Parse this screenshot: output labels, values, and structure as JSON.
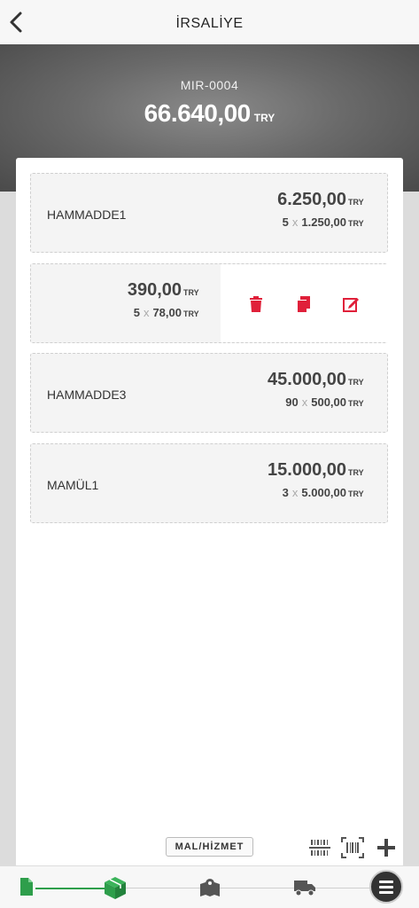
{
  "header": {
    "title": "İRSALİYE",
    "back_icon": "chevron-left-icon"
  },
  "summary": {
    "document_no": "MIR-0004",
    "total": "66.640,00",
    "currency": "TRY"
  },
  "items": [
    {
      "name": "HAMMADDE1",
      "line_total": "6.250,00",
      "currency": "TRY",
      "qty": "5",
      "x": "x",
      "unit_price": "1.250,00",
      "unit_currency": "TRY"
    },
    {
      "name": "",
      "line_total": "390,00",
      "currency": "TRY",
      "qty": "5",
      "x": "x",
      "unit_price": "78,00",
      "unit_currency": "TRY",
      "swiped": true
    },
    {
      "name": "HAMMADDE3",
      "line_total": "45.000,00",
      "currency": "TRY",
      "qty": "90",
      "x": "x",
      "unit_price": "500,00",
      "unit_currency": "TRY"
    },
    {
      "name": "MAMÜL1",
      "line_total": "15.000,00",
      "currency": "TRY",
      "qty": "3",
      "x": "x",
      "unit_price": "5.000,00",
      "unit_currency": "TRY"
    }
  ],
  "swipe_actions": [
    "trash-icon",
    "copy-icon",
    "edit-icon"
  ],
  "toolbar": {
    "mal_hizmet_label": "MAL/HİZMET"
  },
  "colors": {
    "accent_red": "#e0203a",
    "accent_green": "#2e9e4b",
    "hero_dark": "#4a4a4a"
  },
  "bottom_nav": [
    "document-icon",
    "package-icon",
    "map-icon",
    "truck-icon",
    "menu-icon"
  ]
}
